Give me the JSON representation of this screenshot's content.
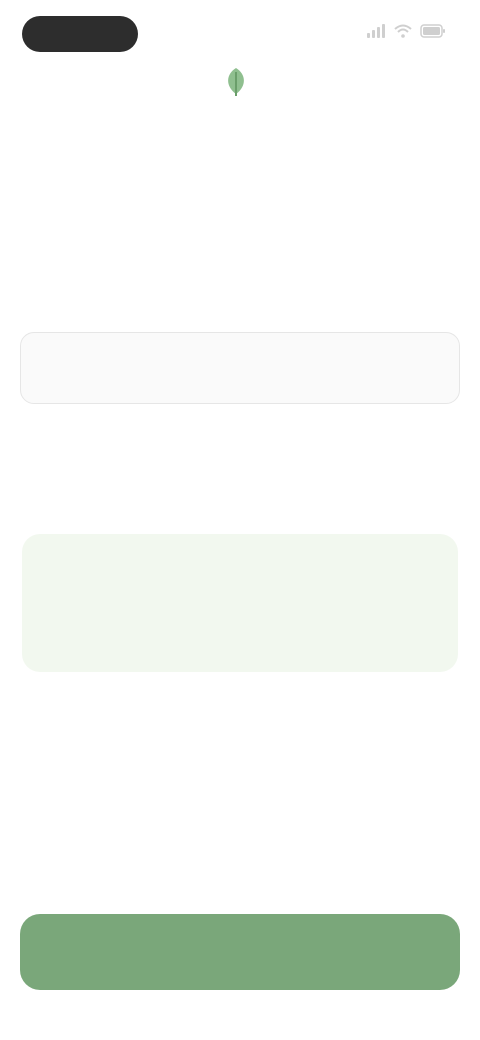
{
  "status_bar": {
    "time": "",
    "icons": [
      "signal-icon",
      "wifi-icon",
      "battery-icon"
    ]
  },
  "brand": {
    "logo_icon": "leaf-icon",
    "name": ""
  },
  "headline": "",
  "email_input": {
    "value": "",
    "placeholder": ""
  },
  "hint": "",
  "info_card": {
    "title": "",
    "body": ""
  },
  "continue_button": {
    "label": ""
  },
  "colors": {
    "accent": "#7aa77a",
    "card_bg": "#f2f8ef",
    "text": "#1f1f1f",
    "muted": "#8a8a8a"
  }
}
